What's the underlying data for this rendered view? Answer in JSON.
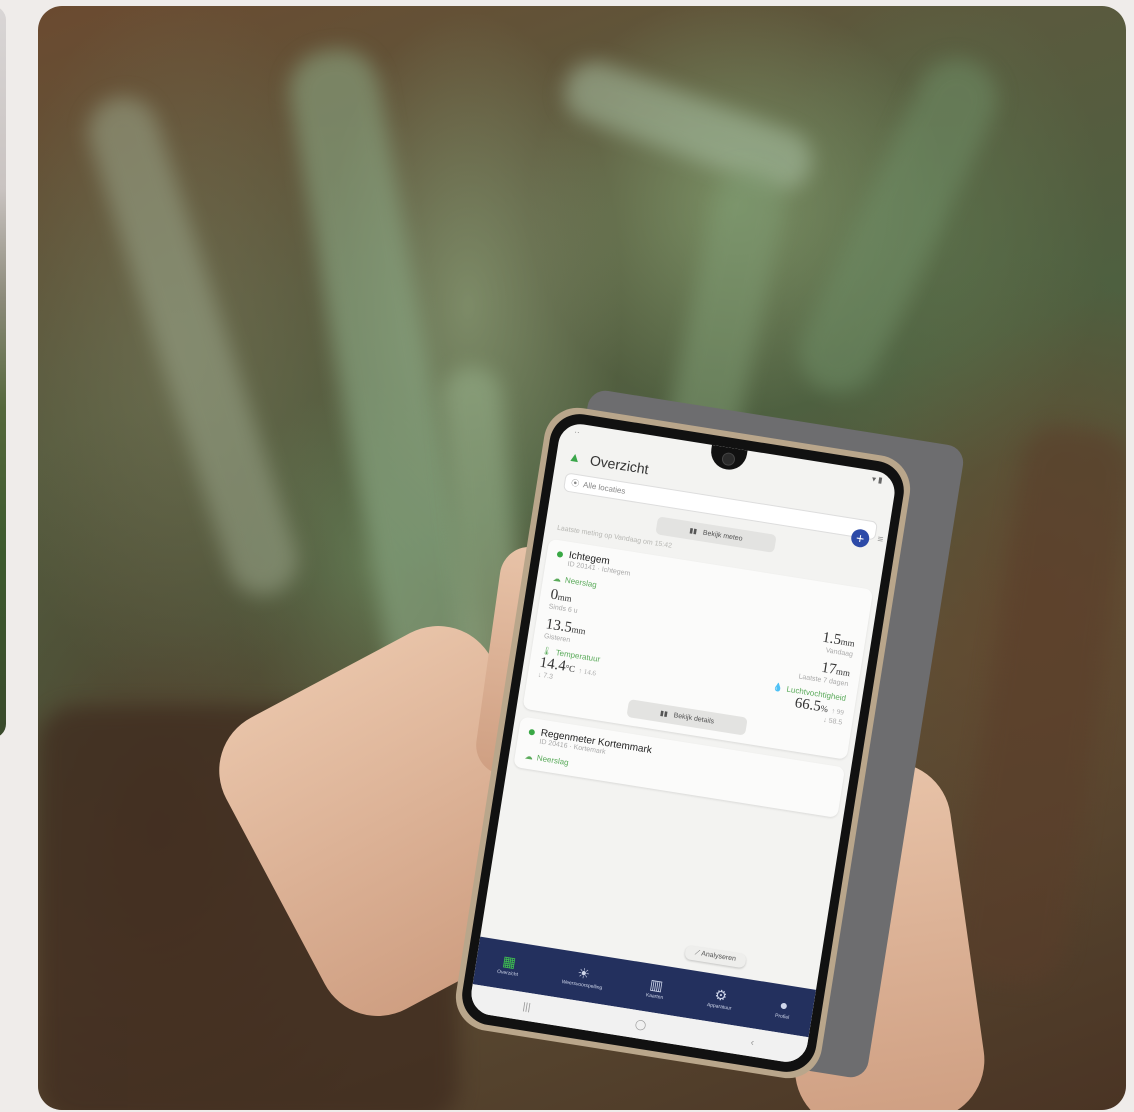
{
  "app": {
    "title": "Overzicht",
    "location": "Alle locaties",
    "add_icon": "plus-icon",
    "menu_icon": "filter-icon"
  },
  "top_card": {
    "button_label": "Bekijk meteo",
    "info_text": "Laatste meting op Vandaag om 15:42"
  },
  "station": {
    "name": "Ichtegem",
    "subtitle": "ID 20141 · Ichtegem",
    "precip_label": "Neerslag",
    "precip_now": "0",
    "precip_now_unit": "mm",
    "precip_now_label": "Sinds 6 u",
    "precip_yesterday": "1.5",
    "precip_yesterday_unit": "mm",
    "precip_yesterday_label": "Vandaag",
    "precip_week": "13.5",
    "precip_week_unit": "mm",
    "precip_week_label": "Gisteren",
    "precip_7d": "17",
    "precip_7d_unit": "mm",
    "precip_7d_label": "Laatste 7 dagen",
    "temp_label": "Temperatuur",
    "temp_value": "14.4",
    "temp_unit": "°C",
    "temp_up": "↑ 14.6",
    "temp_down": "↓ 7.3",
    "humidity_label": "Luchtvochtigheid",
    "humidity_value": "66.5",
    "humidity_unit": "%",
    "humidity_up": "↑ 99",
    "humidity_down": "↓ 58.5",
    "button_label": "Bekijk details"
  },
  "station2": {
    "name": "Regenmeter Kortemmark",
    "subtitle": "ID 20416 · Kortemark",
    "precip_label": "Neerslag"
  },
  "float_button": "Analyseren",
  "nav": [
    {
      "label": "Overzicht",
      "icon": "grid-icon",
      "active": true
    },
    {
      "label": "Weersvoorspelling",
      "icon": "weather-icon",
      "active": false
    },
    {
      "label": "Kaarten",
      "icon": "map-icon",
      "active": false
    },
    {
      "label": "Apparatuur",
      "icon": "device-icon",
      "active": false
    },
    {
      "label": "Profiel",
      "icon": "profile-icon",
      "active": false
    }
  ],
  "colors": {
    "accent_green": "#39a845",
    "nav_background": "#23305e",
    "add_button": "#2c4aa8"
  }
}
